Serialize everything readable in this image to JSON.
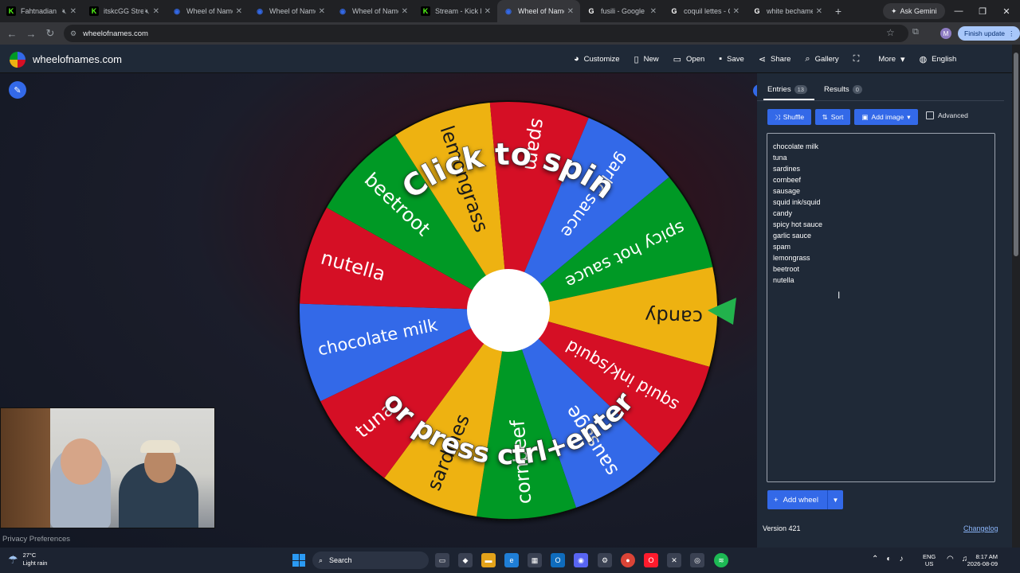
{
  "browser": {
    "tabs": [
      {
        "title": "Fahtnadian",
        "icon": "kick-icon",
        "color": "#53fc18",
        "muted": true
      },
      {
        "title": "itskcGG Stre",
        "icon": "kick-icon",
        "color": "#53fc18",
        "muted": true
      },
      {
        "title": "Wheel of Name",
        "icon": "wheel-icon",
        "color": "#3369e8",
        "muted": false
      },
      {
        "title": "Wheel of Name",
        "icon": "wheel-icon",
        "color": "#3369e8",
        "muted": false
      },
      {
        "title": "Wheel of Name",
        "icon": "wheel-icon",
        "color": "#3369e8",
        "muted": false
      },
      {
        "title": "Stream - Kick D",
        "icon": "kick-icon",
        "color": "#53fc18",
        "muted": false
      },
      {
        "title": "Wheel of Name",
        "icon": "wheel-icon",
        "color": "#3369e8",
        "muted": false,
        "active": true
      },
      {
        "title": "fusili - Google S",
        "icon": "google-icon",
        "color": "#ffffff",
        "muted": false
      },
      {
        "title": "coquil lettes - G",
        "icon": "google-icon",
        "color": "#ffffff",
        "muted": false
      },
      {
        "title": "white bechamel",
        "icon": "google-icon",
        "color": "#ffffff",
        "muted": false
      }
    ],
    "ask_gemini": "Ask Gemini",
    "url": "wheelofnames.com",
    "finish_update": "Finish update",
    "profile_initial": "M"
  },
  "app": {
    "brand": "wheelofnames.com",
    "menu": [
      {
        "label": "Customize",
        "icon": "palette-icon"
      },
      {
        "label": "New",
        "icon": "file-icon"
      },
      {
        "label": "Open",
        "icon": "folder-icon"
      },
      {
        "label": "Save",
        "icon": "save-icon"
      },
      {
        "label": "Share",
        "icon": "share-icon"
      },
      {
        "label": "Gallery",
        "icon": "search-icon"
      },
      {
        "label": "",
        "icon": "fullscreen-icon"
      },
      {
        "label": "More",
        "icon": "chevron-down-icon"
      },
      {
        "label": "English",
        "icon": "globe-icon"
      }
    ]
  },
  "wheel": {
    "segments": [
      {
        "label": "chocolate milk",
        "color": "#3369e8"
      },
      {
        "label": "nutella",
        "color": "#d50f25"
      },
      {
        "label": "beetroot",
        "color": "#009925"
      },
      {
        "label": "lemongrass",
        "color": "#eeb211"
      },
      {
        "label": "spam",
        "color": "#d50f25"
      },
      {
        "label": "garlic sauce",
        "color": "#3369e8"
      },
      {
        "label": "spicy hot sauce",
        "color": "#009925"
      },
      {
        "label": "candy",
        "color": "#eeb211"
      },
      {
        "label": "squid ink/squid",
        "color": "#d50f25"
      },
      {
        "label": "sausage",
        "color": "#3369e8"
      },
      {
        "label": "cornbeef",
        "color": "#009925"
      },
      {
        "label": "sardines",
        "color": "#eeb211"
      },
      {
        "label": "tuna",
        "color": "#d50f25"
      }
    ],
    "click_text": "Click to spin",
    "press_text": "or press ctrl+enter"
  },
  "sidebar": {
    "entries_tab": "Entries",
    "entries_count": "13",
    "results_tab": "Results",
    "results_count": "0",
    "shuffle": "Shuffle",
    "sort": "Sort",
    "add_image": "Add image",
    "advanced": "Advanced",
    "entries": [
      "chocolate milk",
      "tuna",
      "sardines",
      "cornbeef",
      "sausage",
      "squid ink/squid",
      "candy",
      "spicy hot sauce",
      "garlic sauce",
      "spam",
      "lemongrass",
      "beetroot",
      "nutella"
    ],
    "add_wheel": "Add wheel",
    "version": "Version 421",
    "changelog": "Changelog"
  },
  "privacy": "Privacy Preferences",
  "taskbar": {
    "temp": "27°C",
    "weather": "Light rain",
    "search": "Search",
    "lang1": "ENG",
    "lang2": "US",
    "time": "8:17 AM",
    "date": "2026-08-09"
  }
}
